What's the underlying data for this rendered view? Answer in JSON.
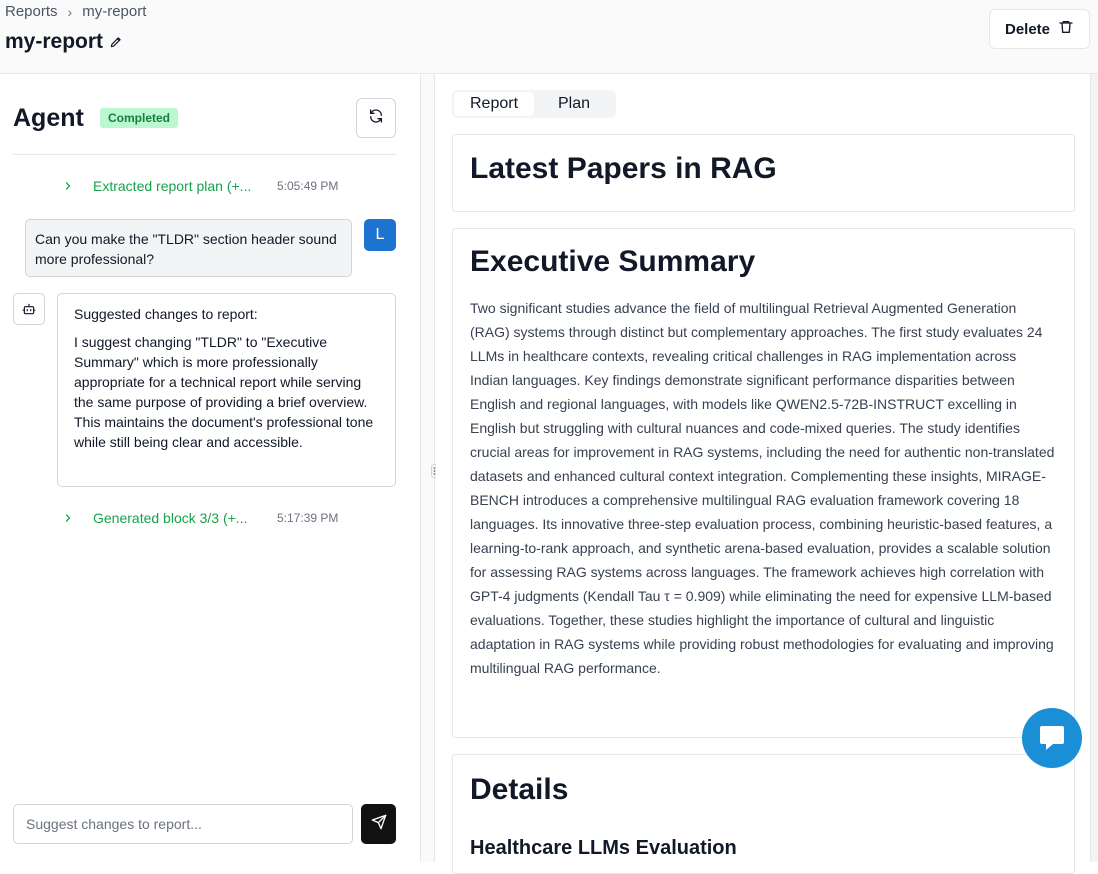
{
  "breadcrumb": {
    "root": "Reports",
    "current": "my-report"
  },
  "header": {
    "title": "my-report",
    "delete_label": "Delete"
  },
  "agent": {
    "title": "Agent",
    "status": "Completed",
    "steps": [
      {
        "label": "Extracted report plan (+...",
        "time": "5:05:49 PM"
      },
      {
        "label": "Generated block 3/3 (+...",
        "time": "5:17:39 PM"
      }
    ],
    "user_message": "Can you make the \"TLDR\" section header sound more professional?",
    "user_initial": "L",
    "bot_message": {
      "heading": "Suggested changes to report:",
      "body": "I suggest changing \"TLDR\" to \"Executive Summary\" which is more professionally appropriate for a technical report while serving the same purpose of providing a brief overview. This maintains the document's professional tone while still being clear and accessible."
    },
    "input_placeholder": "Suggest changes to report..."
  },
  "tabs": [
    {
      "label": "Report"
    },
    {
      "label": "Plan"
    }
  ],
  "report": {
    "title": "Latest Papers in RAG",
    "summary_heading": "Executive Summary",
    "summary_text": "Two significant studies advance the field of multilingual Retrieval Augmented Generation (RAG) systems through distinct but complementary approaches. The first study evaluates 24 LLMs in healthcare contexts, revealing critical challenges in RAG implementation across Indian languages. Key findings demonstrate significant performance disparities between English and regional languages, with models like QWEN2.5-72B-INSTRUCT excelling in English but struggling with cultural nuances and code-mixed queries. The study identifies crucial areas for improvement in RAG systems, including the need for authentic non-translated datasets and enhanced cultural context integration. Complementing these insights, MIRAGE-BENCH introduces a comprehensive multilingual RAG evaluation framework covering 18 languages. Its innovative three-step evaluation process, combining heuristic-based features, a learning-to-rank approach, and synthetic arena-based evaluation, provides a scalable solution for assessing RAG systems across languages. The framework achieves high correlation with GPT-4 judgments (Kendall Tau τ = 0.909) while eliminating the need for expensive LLM-based evaluations. Together, these studies highlight the importance of cultural and linguistic adaptation in RAG systems while providing robust methodologies for evaluating and improving multilingual RAG performance.",
    "details_heading": "Details",
    "details_subheading": "Healthcare LLMs Evaluation"
  },
  "icons": {
    "pencil": "pencil-icon",
    "trash": "trash-icon",
    "refresh": "refresh-icon",
    "chevron": "chevron-right-icon",
    "bot": "bot-icon",
    "send": "send-icon",
    "drag": "drag-handle-icon",
    "chat": "chat-bubble-icon"
  },
  "colors": {
    "accent_green": "#16a34a",
    "badge_bg": "#bbf7d0",
    "avatar_blue": "#1d74d0",
    "fab_blue": "#1a8fd6"
  }
}
